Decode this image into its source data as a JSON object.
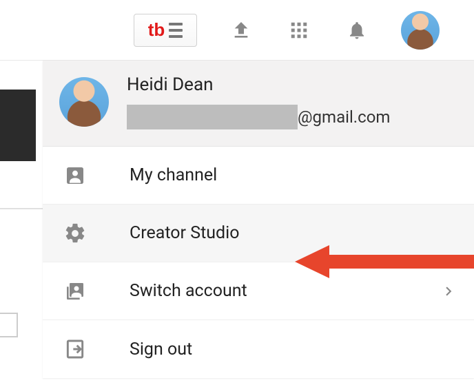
{
  "profile": {
    "name": "Heidi Dean",
    "email_suffix": "@gmail.com"
  },
  "menu": {
    "my_channel": "My channel",
    "creator_studio": "Creator Studio",
    "switch_account": "Switch account",
    "sign_out": "Sign out"
  },
  "icons": {
    "tb_logo": "tb"
  }
}
